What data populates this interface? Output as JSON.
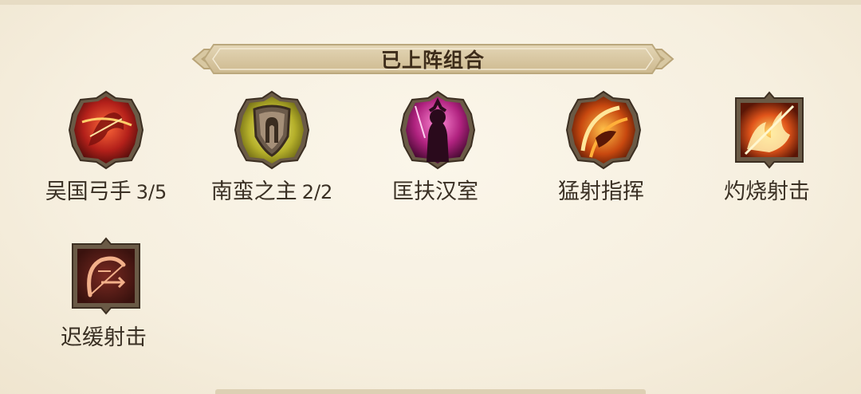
{
  "panel": {
    "title": "已上阵组合"
  },
  "traits": [
    {
      "name": "吴国弓手",
      "count": "3/5",
      "icon": "wu-archer-icon"
    },
    {
      "name": "南蛮之主",
      "count": "2/2",
      "icon": "nanman-lord-shield-icon"
    },
    {
      "name": "匡扶汉室",
      "count": "",
      "icon": "restore-han-icon"
    },
    {
      "name": "猛射指挥",
      "count": "",
      "icon": "fierce-shot-command-icon"
    },
    {
      "name": "灼烧射击",
      "count": "",
      "icon": "burning-shot-icon"
    },
    {
      "name": "迟缓射击",
      "count": "",
      "icon": "slowing-shot-bow-icon"
    }
  ],
  "colors": {
    "background": "#f6efdf",
    "banner": "#d9c9a6",
    "text": "#3a3024"
  }
}
